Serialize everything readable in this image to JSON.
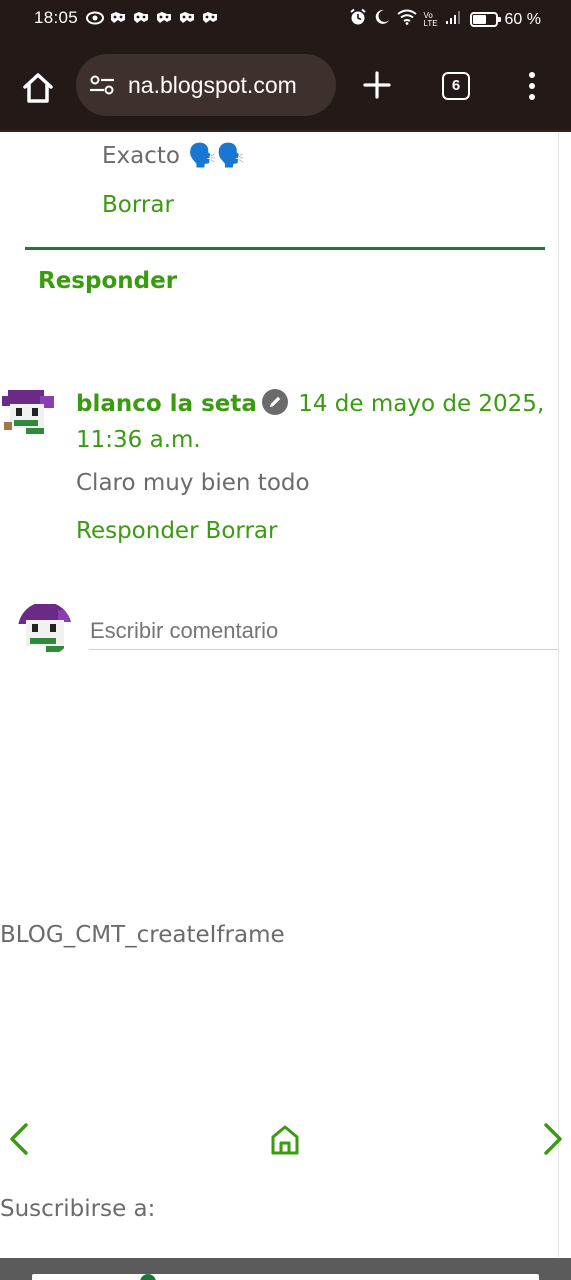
{
  "status_bar": {
    "time": "18:05",
    "battery_text": "60 %",
    "battery_level": 0.6,
    "network_label": "Vo LTE",
    "icons": [
      "eye-icon",
      "game-icon",
      "game-icon",
      "game-icon",
      "game-icon",
      "game-icon",
      "alarm-icon",
      "moon-icon",
      "wifi-icon",
      "signal-icon",
      "battery-icon"
    ]
  },
  "browser": {
    "url": "na.blogspot.com",
    "tab_count": "6",
    "icons": [
      "home-icon",
      "site-settings-icon",
      "plus-icon",
      "tabs-icon",
      "more-vert-icon"
    ]
  },
  "thread": {
    "previous_reply": {
      "text": "Exacto",
      "emoji": "🗣️🗣️",
      "delete_label": "Borrar"
    },
    "reply_label": "Responder",
    "comment": {
      "author": "blanco la seta",
      "date": "14 de mayo de 2025, 11:36 a.m.",
      "body": "Claro muy bien todo",
      "reply_label": "Responder",
      "delete_label": "Borrar"
    },
    "compose": {
      "placeholder": "Escribir comentario"
    }
  },
  "footer": {
    "iframe_text": "BLOG_CMT_createIframe",
    "subscribe_text": "Suscribirse a:"
  },
  "colors": {
    "link_green": "#3a9b11",
    "divider_green": "#1d7a35",
    "toolbar_bg": "#231917",
    "url_pill_bg": "#3e302d",
    "text_gray": "#6b6b6b"
  }
}
